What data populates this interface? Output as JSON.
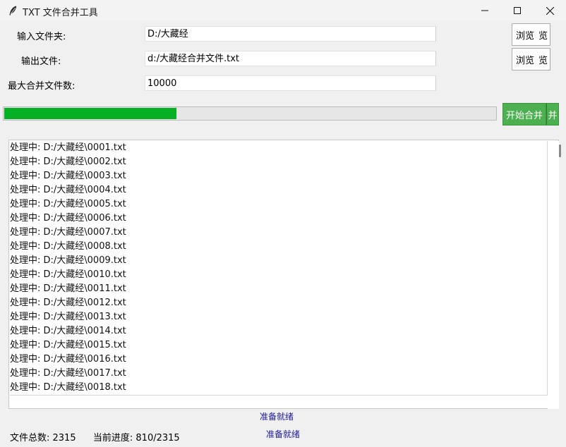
{
  "window": {
    "title": "TXT 文件合并工具",
    "app_icon": "feather-icon",
    "controls": {
      "minimize": "minimize-icon",
      "maximize": "maximize-icon",
      "close": "close-icon"
    }
  },
  "form": {
    "input_folder_label": "输入文件夹:",
    "input_folder_value": "D:/大藏经",
    "output_file_label": "输出文件:",
    "output_file_value": "d:/大藏经合并文件.txt",
    "max_files_label": "最大合并文件数:",
    "max_files_value": "10000",
    "browse_label": "浏览",
    "browse_label_clipped": "览"
  },
  "progress": {
    "fraction": 0.35,
    "color": "#06b025"
  },
  "start_button": {
    "label": "开始合并",
    "label_clipped": "并",
    "color": "#4caf50"
  },
  "log": {
    "lines": [
      "处理中: D:/大藏经\\0001.txt",
      "处理中: D:/大藏经\\0002.txt",
      "处理中: D:/大藏经\\0003.txt",
      "处理中: D:/大藏经\\0004.txt",
      "处理中: D:/大藏经\\0005.txt",
      "处理中: D:/大藏经\\0006.txt",
      "处理中: D:/大藏经\\0007.txt",
      "处理中: D:/大藏经\\0008.txt",
      "处理中: D:/大藏经\\0009.txt",
      "处理中: D:/大藏经\\0010.txt",
      "处理中: D:/大藏经\\0011.txt",
      "处理中: D:/大藏经\\0012.txt",
      "处理中: D:/大藏经\\0013.txt",
      "处理中: D:/大藏经\\0014.txt",
      "处理中: D:/大藏经\\0015.txt",
      "处理中: D:/大藏经\\0016.txt",
      "处理中: D:/大藏经\\0017.txt",
      "处理中: D:/大藏经\\0018.txt"
    ]
  },
  "status": {
    "ready_1": "准备就绪",
    "ready_2": "准备就绪",
    "total_files": "文件总数: 2315",
    "current_progress": "当前进度: 810/2315"
  }
}
